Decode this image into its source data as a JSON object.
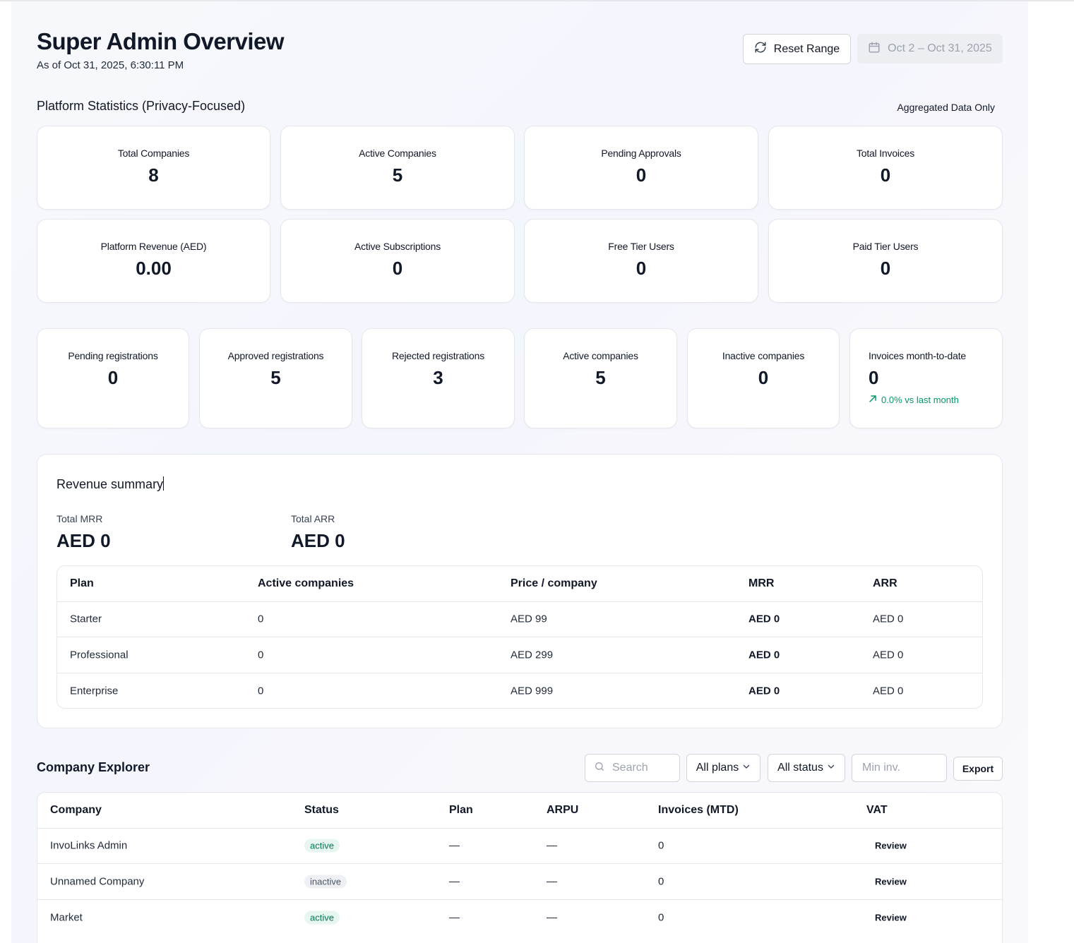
{
  "header": {
    "title": "Super Admin Overview",
    "as_of": "As of Oct 31, 2025, 6:30:11 PM",
    "reset_label": "Reset Range",
    "date_range": "Oct 2 – Oct 31, 2025"
  },
  "platform": {
    "title": "Platform Statistics (Privacy-Focused)",
    "badge": "Aggregated Data Only",
    "cards": [
      {
        "label": "Total Companies",
        "value": "8"
      },
      {
        "label": "Active Companies",
        "value": "5"
      },
      {
        "label": "Pending Approvals",
        "value": "0"
      },
      {
        "label": "Total Invoices",
        "value": "0"
      },
      {
        "label": "Platform Revenue (AED)",
        "value": "0.00"
      },
      {
        "label": "Active Subscriptions",
        "value": "0"
      },
      {
        "label": "Free Tier Users",
        "value": "0"
      },
      {
        "label": "Paid Tier Users",
        "value": "0"
      }
    ]
  },
  "registrations": {
    "cards": [
      {
        "label": "Pending registrations",
        "value": "0"
      },
      {
        "label": "Approved registrations",
        "value": "5"
      },
      {
        "label": "Rejected registrations",
        "value": "3"
      },
      {
        "label": "Active companies",
        "value": "5"
      },
      {
        "label": "Inactive companies",
        "value": "0"
      },
      {
        "label": "Invoices month-to-date",
        "value": "0"
      }
    ],
    "trend": "0.0% vs last month",
    "trend_color": "#059669"
  },
  "revenue": {
    "title": "Revenue summary",
    "mrr_label": "Total MRR",
    "mrr_value": "AED 0",
    "arr_label": "Total ARR",
    "arr_value": "AED 0",
    "columns": [
      "Plan",
      "Active companies",
      "Price / company",
      "MRR",
      "ARR"
    ],
    "rows": [
      {
        "plan": "Starter",
        "active": "0",
        "price": "AED 99",
        "mrr": "AED 0",
        "arr": "AED 0"
      },
      {
        "plan": "Professional",
        "active": "0",
        "price": "AED 299",
        "mrr": "AED 0",
        "arr": "AED 0"
      },
      {
        "plan": "Enterprise",
        "active": "0",
        "price": "AED 999",
        "mrr": "AED 0",
        "arr": "AED 0"
      }
    ]
  },
  "explorer": {
    "title": "Company Explorer",
    "search_placeholder": "Search",
    "plans_label": "All plans",
    "status_label": "All status",
    "min_inv_placeholder": "Min inv.",
    "export_label": "Export",
    "columns": [
      "Company",
      "Status",
      "Plan",
      "ARPU",
      "Invoices (MTD)",
      "VAT"
    ],
    "rows": [
      {
        "company": "InvoLinks Admin",
        "status": "active",
        "plan": "—",
        "arpu": "—",
        "invoices": "0",
        "vat": "Review"
      },
      {
        "company": "Unnamed Company",
        "status": "inactive",
        "plan": "—",
        "arpu": "—",
        "invoices": "0",
        "vat": "Review"
      },
      {
        "company": "Market",
        "status": "active",
        "plan": "—",
        "arpu": "—",
        "invoices": "0",
        "vat": "Review"
      }
    ]
  },
  "icons": {
    "reset": "refresh-icon",
    "date": "calendar-icon",
    "search": "search-icon",
    "chevron": "chevron-down-icon",
    "trend": "arrow-up-right-icon"
  }
}
